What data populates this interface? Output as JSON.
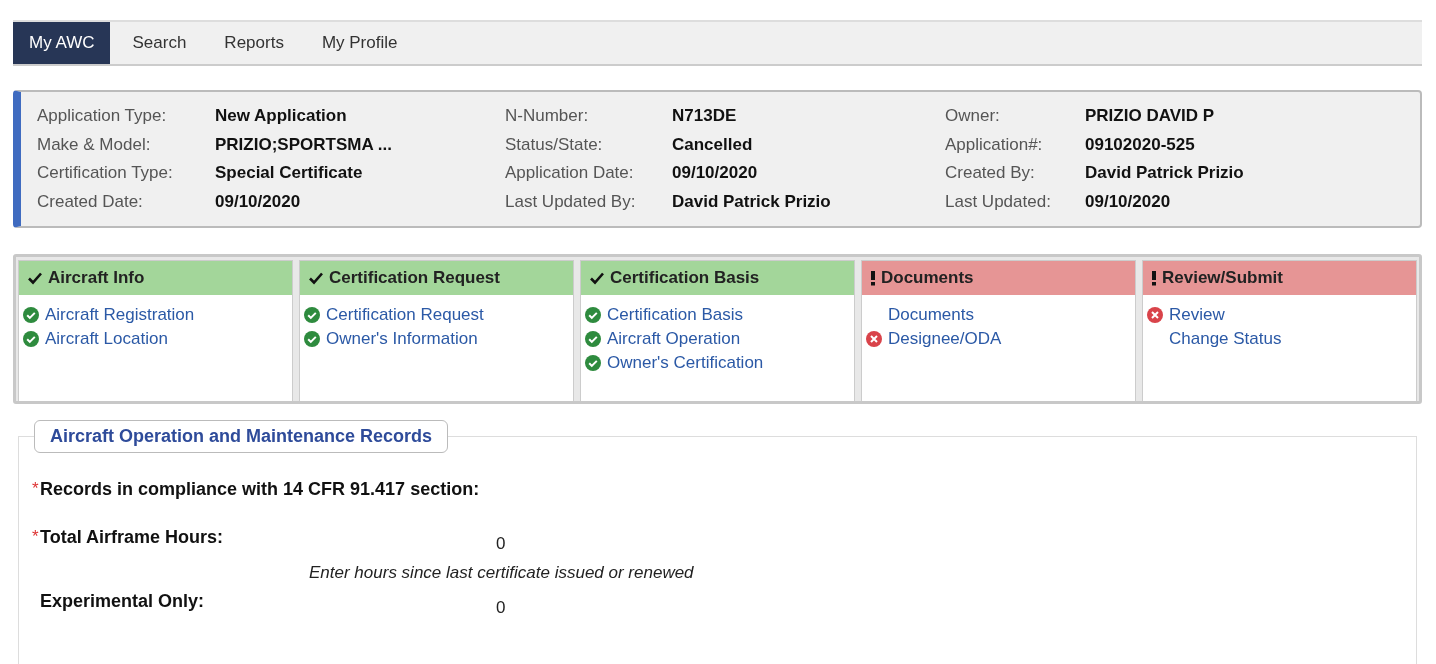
{
  "nav": {
    "tabs": [
      {
        "label": "My AWC",
        "selected": true
      },
      {
        "label": "Search",
        "selected": false
      },
      {
        "label": "Reports",
        "selected": false
      },
      {
        "label": "My Profile",
        "selected": false
      }
    ]
  },
  "info": {
    "columns": [
      [
        {
          "label": "Application Type:",
          "value": "New Application"
        },
        {
          "label": "Make & Model:",
          "value": "PRIZIO;SPORTSMA ..."
        },
        {
          "label": "Certification Type:",
          "value": "Special Certificate"
        },
        {
          "label": "Created Date:",
          "value": "09/10/2020"
        }
      ],
      [
        {
          "label": "N-Number:",
          "value": "N713DE"
        },
        {
          "label": "Status/State:",
          "value": "Cancelled"
        },
        {
          "label": "Application Date:",
          "value": "09/10/2020"
        },
        {
          "label": "Last Updated By:",
          "value": "David Patrick Prizio"
        }
      ],
      [
        {
          "label": "Owner:",
          "value": "PRIZIO DAVID P"
        },
        {
          "label": "Application#:",
          "value": "09102020-525"
        },
        {
          "label": "Created By:",
          "value": "David Patrick Prizio"
        },
        {
          "label": "Last Updated:",
          "value": "09/10/2020"
        }
      ]
    ]
  },
  "steps": [
    {
      "title": "Aircraft Info",
      "complete": true,
      "items": [
        {
          "label": "Aircraft Registration",
          "kind": "ok"
        },
        {
          "label": "Aircraft Location",
          "kind": "ok"
        }
      ]
    },
    {
      "title": "Certification Request",
      "complete": true,
      "items": [
        {
          "label": "Certification Request",
          "kind": "ok"
        },
        {
          "label": "Owner's Information",
          "kind": "ok"
        }
      ]
    },
    {
      "title": "Certification Basis",
      "complete": true,
      "items": [
        {
          "label": "Certification Basis",
          "kind": "ok"
        },
        {
          "label": "Aircraft Operation",
          "kind": "ok"
        },
        {
          "label": "Owner's Certification",
          "kind": "ok"
        }
      ]
    },
    {
      "title": "Documents",
      "complete": false,
      "items": [
        {
          "label": "Documents",
          "kind": "plain"
        },
        {
          "label": "Designee/ODA",
          "kind": "error"
        }
      ]
    },
    {
      "title": "Review/Submit",
      "complete": false,
      "items": [
        {
          "label": "Review",
          "kind": "error"
        },
        {
          "label": "Change Status",
          "kind": "plain"
        }
      ]
    }
  ],
  "section": {
    "legend": "Aircraft Operation and Maintenance Records",
    "fields": [
      {
        "required_mark": "*",
        "label": "Records in compliance with 14 CFR 91.417 section:"
      },
      {
        "required_mark": "*",
        "label": "Total Airframe Hours:",
        "value": "0"
      },
      {
        "hint": "Enter hours since last certificate issued or renewed",
        "label": "Experimental Only:",
        "value": "0"
      }
    ]
  }
}
